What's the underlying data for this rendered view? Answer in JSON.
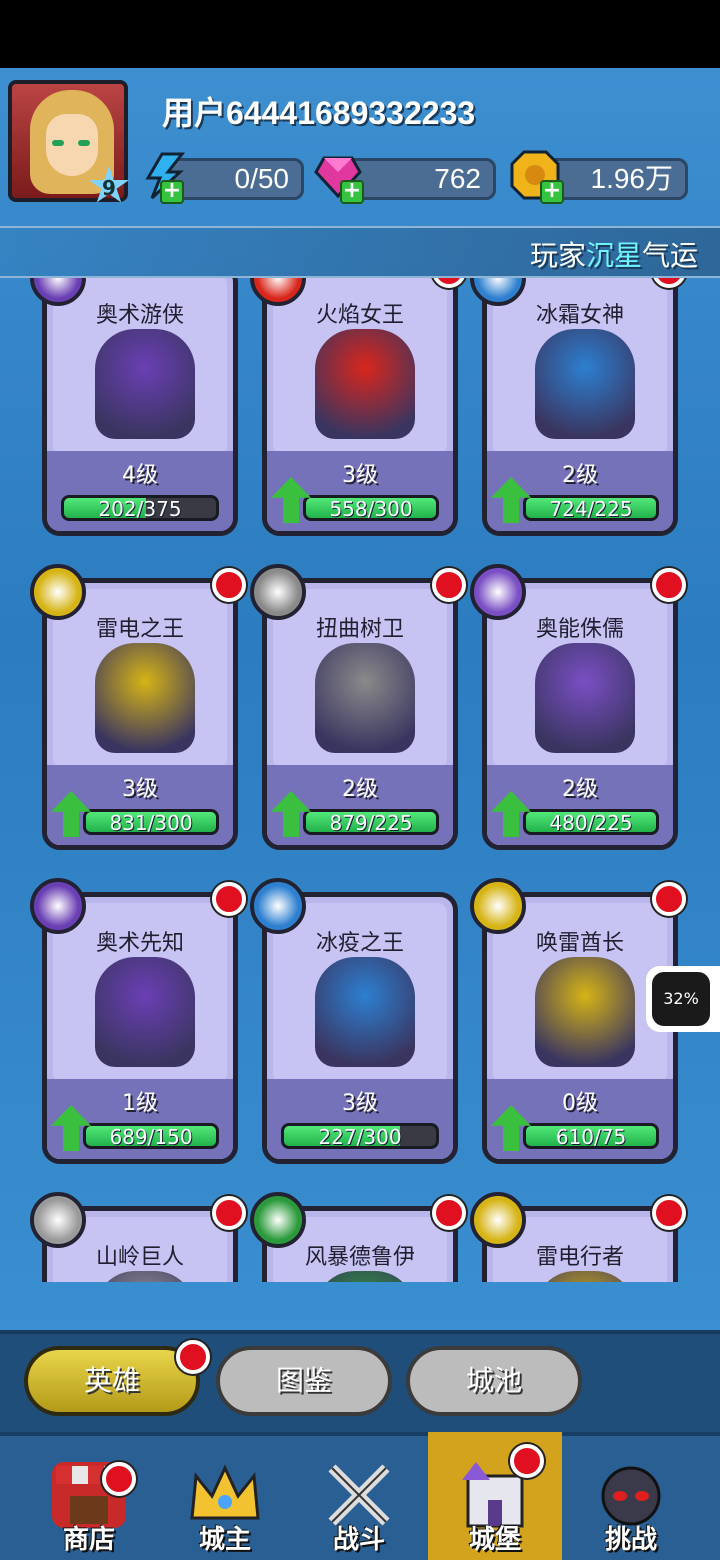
{
  "player": {
    "username": "用户64441689332233",
    "level": "9",
    "energy": "0/50",
    "gems": "762",
    "gold": "1.96万"
  },
  "banner": {
    "prefix": "玩家",
    "highlight": "沉星",
    "suffix": "气运"
  },
  "heroes": [
    {
      "name": "奥术游侠",
      "level": "4级",
      "progress_text": "202/375",
      "progress": 0.54,
      "upgradable": false,
      "new": false,
      "element_color": "#6a3fb4"
    },
    {
      "name": "火焰女王",
      "level": "3级",
      "progress_text": "558/300",
      "progress": 1.0,
      "upgradable": true,
      "new": true,
      "element_color": "#d9261c"
    },
    {
      "name": "冰霜女神",
      "level": "2级",
      "progress_text": "724/225",
      "progress": 1.0,
      "upgradable": true,
      "new": true,
      "element_color": "#2d7fd0"
    },
    {
      "name": "雷电之王",
      "level": "3级",
      "progress_text": "831/300",
      "progress": 1.0,
      "upgradable": true,
      "new": true,
      "element_color": "#d6b416"
    },
    {
      "name": "扭曲树卫",
      "level": "2级",
      "progress_text": "879/225",
      "progress": 1.0,
      "upgradable": true,
      "new": true,
      "element_color": "#8a8a8a"
    },
    {
      "name": "奥能侏儒",
      "level": "2级",
      "progress_text": "480/225",
      "progress": 1.0,
      "upgradable": true,
      "new": true,
      "element_color": "#7a4fc4"
    },
    {
      "name": "奥术先知",
      "level": "1级",
      "progress_text": "689/150",
      "progress": 1.0,
      "upgradable": true,
      "new": true,
      "element_color": "#6a3fb4"
    },
    {
      "name": "冰疫之王",
      "level": "3级",
      "progress_text": "227/300",
      "progress": 0.76,
      "upgradable": false,
      "new": false,
      "element_color": "#2d7fd0"
    },
    {
      "name": "唤雷酋长",
      "level": "0级",
      "progress_text": "610/75",
      "progress": 1.0,
      "upgradable": true,
      "new": true,
      "element_color": "#d6b416"
    },
    {
      "name": "山岭巨人",
      "level": "",
      "progress_text": "",
      "progress": 0,
      "upgradable": false,
      "new": true,
      "element_color": "#9a9a9a"
    },
    {
      "name": "风暴德鲁伊",
      "level": "",
      "progress_text": "",
      "progress": 0,
      "upgradable": false,
      "new": true,
      "element_color": "#2a9a3a"
    },
    {
      "name": "雷电行者",
      "level": "",
      "progress_text": "",
      "progress": 0,
      "upgradable": false,
      "new": true,
      "element_color": "#d6b416"
    }
  ],
  "side_badge": {
    "percent": "32%"
  },
  "tabs": {
    "heroes": "英雄",
    "codex": "图鉴",
    "city": "城池"
  },
  "nav": {
    "shop": "商店",
    "lord": "城主",
    "battle": "战斗",
    "castle": "城堡",
    "challenge": "挑战"
  }
}
